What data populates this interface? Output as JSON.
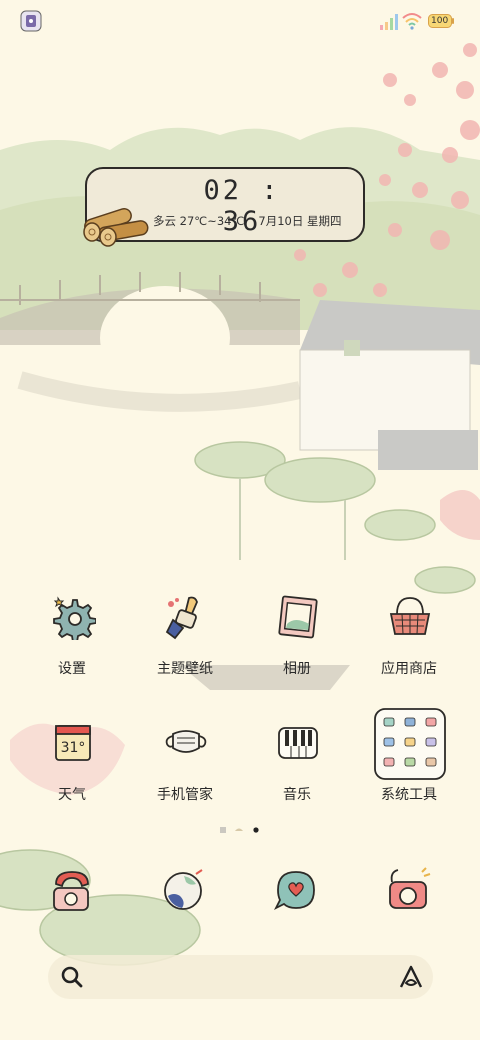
{
  "status_bar": {
    "battery": "100"
  },
  "clock": {
    "time": "02 : 36",
    "weather": "多云 27℃~34℃",
    "date": "7月10日 星期四"
  },
  "apps": [
    {
      "label": "设置",
      "icon": "gear-icon"
    },
    {
      "label": "主题壁纸",
      "icon": "paintbrush-icon"
    },
    {
      "label": "相册",
      "icon": "photo-frame-icon"
    },
    {
      "label": "应用商店",
      "icon": "basket-icon"
    },
    {
      "label": "天气",
      "icon": "calendar-icon",
      "icon_text": "31°"
    },
    {
      "label": "手机管家",
      "icon": "mask-icon"
    },
    {
      "label": "音乐",
      "icon": "piano-icon"
    },
    {
      "label": "系统工具",
      "icon": "folder-icon"
    }
  ],
  "dock": [
    {
      "icon": "phone-icon"
    },
    {
      "icon": "globe-icon"
    },
    {
      "icon": "message-heart-icon"
    },
    {
      "icon": "camera-icon"
    }
  ],
  "colors": {
    "background": "#fdf8e6",
    "hills": "#dbe5c5",
    "blossom": "#f2b6b2",
    "outline": "#2d2b28"
  }
}
